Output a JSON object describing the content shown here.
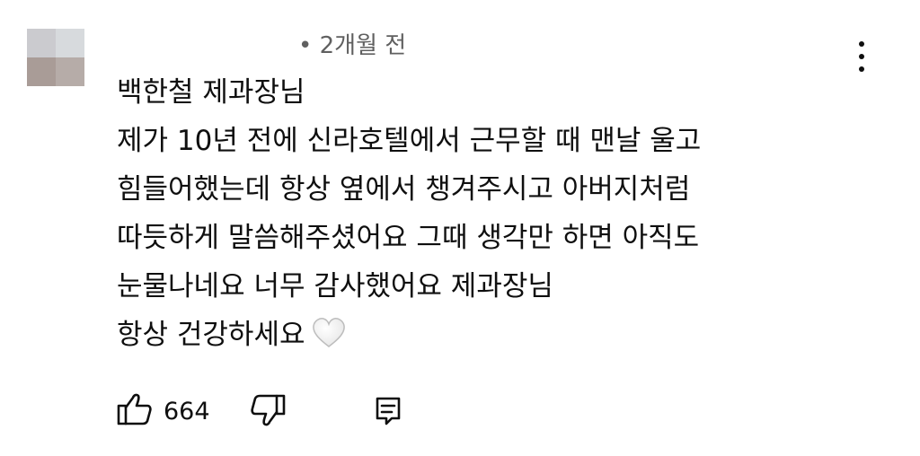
{
  "comment": {
    "time_label": "• 2개월 전",
    "lines": [
      "백한철 제과장님",
      "제가 10년 전에 신라호텔에서 근무할 때 맨날 울고",
      "힘들어했는데 항상 옆에서 챙겨주시고 아버지처럼",
      "따듯하게 말씀해주셨어요 그때 생각만 하면 아직도",
      "눈물나네요 너무 감사했어요 제과장님",
      "항상 건강하세요"
    ],
    "emoji": "heart-icon"
  },
  "actions": {
    "like_count": "664",
    "like_icon": "thumbs-up-icon",
    "dislike_icon": "thumbs-down-icon",
    "reply_icon": "reply-icon",
    "menu_icon": "more-vert-icon"
  }
}
